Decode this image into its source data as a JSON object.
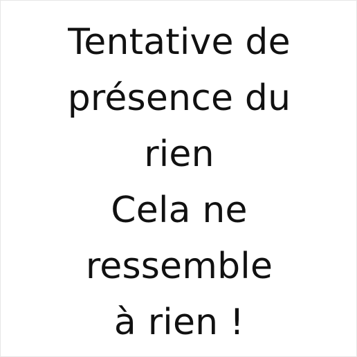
{
  "lines": [
    "Tentative de",
    "présence du",
    "rien",
    "Cela ne",
    "ressemble",
    "à rien !"
  ],
  "colors": {
    "text": "#111111",
    "background": "#ffffff"
  }
}
